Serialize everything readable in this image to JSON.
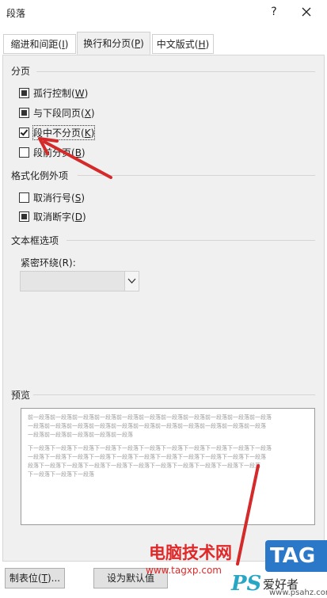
{
  "window": {
    "title": "段落",
    "help_label": "?",
    "close_icon": "close-icon"
  },
  "tabs": [
    {
      "label": "缩进和间距(",
      "key": "I",
      "suffix": ")"
    },
    {
      "label": "换行和分页(",
      "key": "P",
      "suffix": ")"
    },
    {
      "label": "中文版式(",
      "key": "H",
      "suffix": ")"
    }
  ],
  "pagination": {
    "title": "分页",
    "items": [
      {
        "label": "孤行控制(",
        "key": "W",
        "suffix": ")",
        "state": "indeterminate"
      },
      {
        "label": "与下段同页(",
        "key": "X",
        "suffix": ")",
        "state": "indeterminate"
      },
      {
        "label": "段中不分页(",
        "key": "K",
        "suffix": ")",
        "state": "checked"
      },
      {
        "label": "段前分页(",
        "key": "B",
        "suffix": ")",
        "state": "unchecked"
      }
    ]
  },
  "format_exceptions": {
    "title": "格式化例外项",
    "items": [
      {
        "label": "取消行号(",
        "key": "S",
        "suffix": ")",
        "state": "unchecked"
      },
      {
        "label": "取消断字(",
        "key": "D",
        "suffix": ")",
        "state": "indeterminate"
      }
    ]
  },
  "textbox_options": {
    "title": "文本框选项",
    "wrap_label": "紧密环绕(R):",
    "wrap_value": ""
  },
  "preview": {
    "title": "预览",
    "sample_prev": "前一段落前一段落前一段落前一段落前一段落前一段落前一段落前一段落前一段落前一段落前一段落",
    "sample_prev2": "一段落前一段落前一段落前一段落前一段落前一段落前一段落前一段落前一段落前一段落前一段落",
    "sample_prev3": "一段落前一段落前一段落前一段落前一段落",
    "sample_next": "下一段落下一段落下一段落下一段落下一段落下一段落下一段落下一段落下一段落下一段落下一段落",
    "sample_next2": "一段落下一段落下一段落下一段落下一段落下一段落下一段落下一段落下一段落下一段落下一段落",
    "sample_next3": "段落下一段落下一段落下一段落下一段落下一段落下一段落下一段落下一段落下一段落下一段落",
    "sample_next4": "下一段落下一段落下一段落"
  },
  "buttons": {
    "tabs_label": "制表位(",
    "tabs_key": "T",
    "tabs_suffix": ")...",
    "default_label": "设为默认值"
  },
  "watermark": {
    "title": "电脑技术网",
    "url": "www.tagxp.com",
    "badge": "TAG",
    "ps": "PS",
    "site": "爱好者",
    "domain": "www.psahz.com"
  },
  "colors": {
    "accent_arrow": "#d42a2a",
    "panel_bg": "#f0f0f0"
  }
}
